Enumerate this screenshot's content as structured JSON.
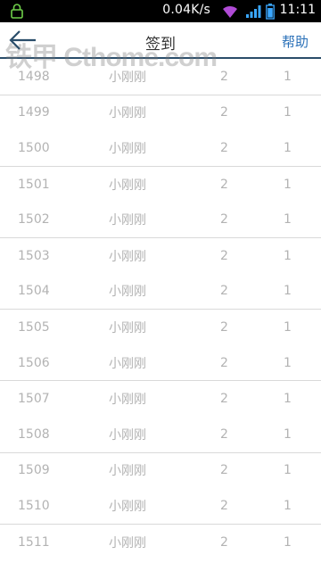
{
  "status_bar": {
    "speed": "0.04K/s",
    "time": "11:11",
    "icons": [
      "lock-icon",
      "wifi-icon",
      "signal-icon",
      "battery-icon"
    ]
  },
  "header": {
    "title": "签到",
    "help_label": "帮助",
    "watermark": "铁甲 Cthome.com",
    "back_icon": "arrow-left-icon"
  },
  "rows": [
    {
      "id": "1498",
      "name": "小刚刚",
      "a": "2",
      "b": "1"
    },
    {
      "id": "1499",
      "name": "小刚刚",
      "a": "2",
      "b": "1"
    },
    {
      "id": "1500",
      "name": "小刚刚",
      "a": "2",
      "b": "1"
    },
    {
      "id": "1501",
      "name": "小刚刚",
      "a": "2",
      "b": "1"
    },
    {
      "id": "1502",
      "name": "小刚刚",
      "a": "2",
      "b": "1"
    },
    {
      "id": "1503",
      "name": "小刚刚",
      "a": "2",
      "b": "1"
    },
    {
      "id": "1504",
      "name": "小刚刚",
      "a": "2",
      "b": "1"
    },
    {
      "id": "1505",
      "name": "小刚刚",
      "a": "2",
      "b": "1"
    },
    {
      "id": "1506",
      "name": "小刚刚",
      "a": "2",
      "b": "1"
    },
    {
      "id": "1507",
      "name": "小刚刚",
      "a": "2",
      "b": "1"
    },
    {
      "id": "1508",
      "name": "小刚刚",
      "a": "2",
      "b": "1"
    },
    {
      "id": "1509",
      "name": "小刚刚",
      "a": "2",
      "b": "1"
    },
    {
      "id": "1510",
      "name": "小刚刚",
      "a": "2",
      "b": "1"
    },
    {
      "id": "1511",
      "name": "小刚刚",
      "a": "2",
      "b": "1"
    }
  ],
  "colors": {
    "accent": "#2a70b8",
    "header_border": "#2a4d6a",
    "row_text": "#b3b3b3",
    "divider": "#d9d9d9"
  }
}
